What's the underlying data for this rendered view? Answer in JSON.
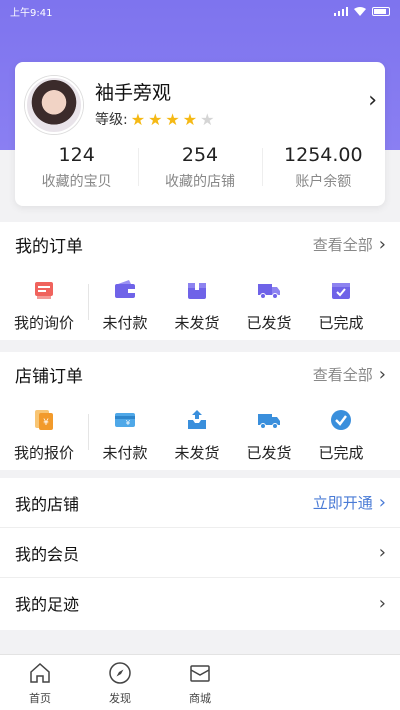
{
  "status": {
    "time": "上午9:41"
  },
  "profile": {
    "name": "袖手旁观",
    "level_label": "等级:",
    "stars_filled": 4,
    "stars_total": 5,
    "stats": [
      {
        "value": "124",
        "label": "收藏的宝贝"
      },
      {
        "value": "254",
        "label": "收藏的店铺"
      },
      {
        "value": "1254.00",
        "label": "账户余额"
      }
    ]
  },
  "my_orders": {
    "title": "我的订单",
    "view_all": "查看全部",
    "items": [
      {
        "label": "我的询价",
        "icon": "inquiry-icon"
      },
      {
        "label": "未付款",
        "icon": "wallet-icon"
      },
      {
        "label": "未发货",
        "icon": "package-icon"
      },
      {
        "label": "已发货",
        "icon": "truck-icon"
      },
      {
        "label": "已完成",
        "icon": "completed-box-icon"
      }
    ]
  },
  "shop_orders": {
    "title": "店铺订单",
    "view_all": "查看全部",
    "items": [
      {
        "label": "我的报价",
        "icon": "quote-icon"
      },
      {
        "label": "未付款",
        "icon": "card-icon"
      },
      {
        "label": "未发货",
        "icon": "outbox-icon"
      },
      {
        "label": "已发货",
        "icon": "truck-icon"
      },
      {
        "label": "已完成",
        "icon": "check-circle-icon"
      }
    ]
  },
  "menu": {
    "my_shop": "我的店铺",
    "open_now": "立即开通",
    "my_members": "我的会员",
    "my_footprints": "我的足迹"
  },
  "tabbar": {
    "items": [
      {
        "label": "首页",
        "icon": "home-icon"
      },
      {
        "label": "发现",
        "icon": "compass-icon"
      },
      {
        "label": "商城",
        "icon": "mall-icon"
      }
    ]
  },
  "colors": {
    "brand": "#7e74ee",
    "star": "#f5b915",
    "link": "#4a7bd6"
  }
}
